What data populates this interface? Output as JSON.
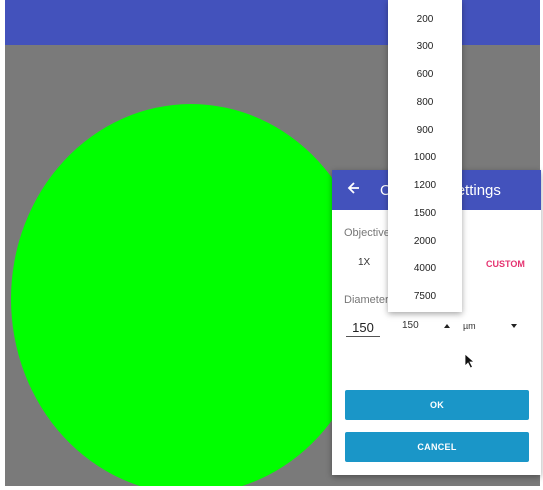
{
  "colors": {
    "primary": "#4352bc",
    "background": "#7a7a7a",
    "circle": "#00ff00",
    "accent": "#e53370",
    "button": "#1a96c8"
  },
  "dialog": {
    "title": "Objective Settings",
    "objective_label": "Objective",
    "objectives": {
      "first": "1X",
      "custom": "CUSTOM"
    },
    "diameter_label": "Diameter",
    "diameter_value": "150",
    "size_select_value": "150",
    "unit_select_value": "µm",
    "ok_label": "OK",
    "cancel_label": "CANCEL"
  },
  "dropdown": {
    "options": [
      "200",
      "300",
      "600",
      "800",
      "900",
      "1000",
      "1200",
      "1500",
      "2000",
      "4000",
      "7500"
    ]
  }
}
